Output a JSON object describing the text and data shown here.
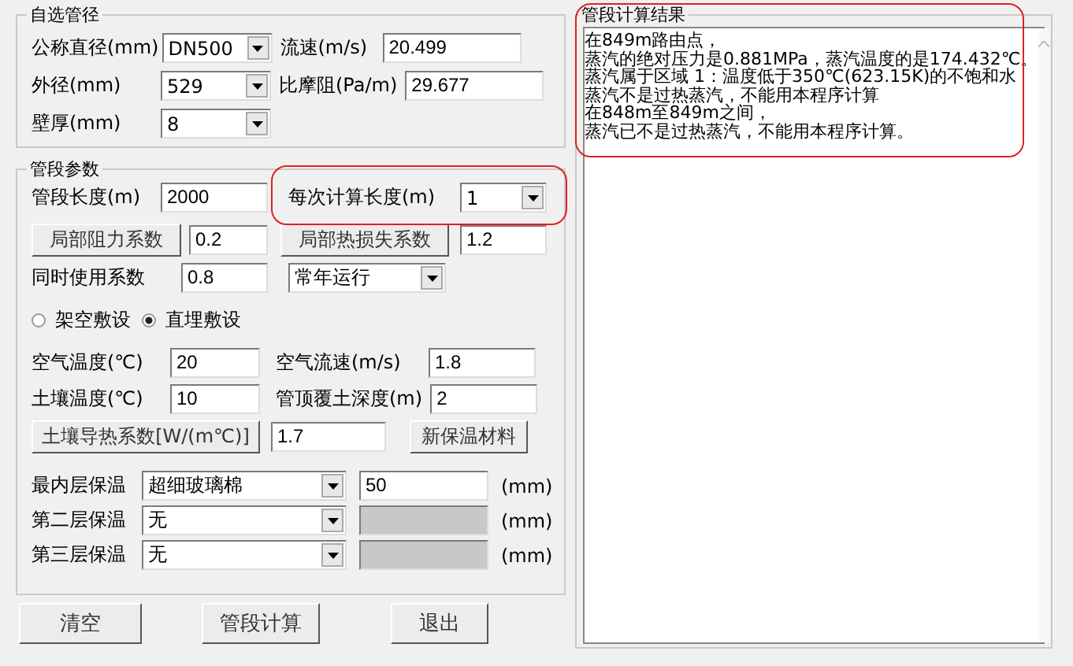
{
  "pipe_size_group": {
    "title": "自选管径",
    "rows": [
      [
        {
          "kind": "label",
          "text": "公称直径(mm)"
        },
        {
          "kind": "dropdown",
          "value": "DN500"
        },
        {
          "kind": "label",
          "text": "流速(m/s)"
        },
        {
          "kind": "input",
          "value": "20.499"
        }
      ],
      [
        {
          "kind": "label",
          "text": "外径(mm)"
        },
        {
          "kind": "dropdown",
          "value": "529"
        },
        {
          "kind": "label",
          "text": "比摩阻(Pa/m)"
        },
        {
          "kind": "input",
          "value": "29.677"
        }
      ],
      [
        {
          "kind": "label",
          "text": "壁厚(mm)"
        },
        {
          "kind": "dropdown",
          "value": "8"
        }
      ]
    ]
  },
  "segment_group": {
    "title": "管段参数",
    "rows": [
      [
        {
          "kind": "label",
          "text": "管段长度(m)"
        },
        {
          "kind": "input",
          "value": "2000"
        },
        {
          "kind": "label",
          "text": "每次计算长度(m)"
        },
        {
          "kind": "dropdown",
          "value": "1"
        }
      ],
      [
        {
          "kind": "button",
          "text": "局部阻力系数"
        },
        {
          "kind": "input",
          "value": "0.2"
        },
        {
          "kind": "button",
          "text": "局部热损失系数"
        },
        {
          "kind": "input",
          "value": "1.2"
        }
      ],
      [
        {
          "kind": "label",
          "text": "同时使用系数"
        },
        {
          "kind": "input",
          "value": "0.8"
        },
        {
          "kind": "dropdown",
          "value": "常年运行"
        }
      ],
      [
        {
          "kind": "radio",
          "text": "架空敷设",
          "selected": false
        },
        {
          "kind": "radio",
          "text": "直埋敷设",
          "selected": true
        }
      ],
      [
        {
          "kind": "label",
          "text": "空气温度(℃)"
        },
        {
          "kind": "input",
          "value": "20"
        },
        {
          "kind": "label",
          "text": "空气流速(m/s)"
        },
        {
          "kind": "input",
          "value": "1.8"
        }
      ],
      [
        {
          "kind": "label",
          "text": "土壤温度(℃)"
        },
        {
          "kind": "input",
          "value": "10"
        },
        {
          "kind": "label",
          "text": "管顶覆土深度(m)"
        },
        {
          "kind": "input",
          "value": "2"
        }
      ],
      [
        {
          "kind": "button",
          "text": "土壤导热系数[W/(m℃)]"
        },
        {
          "kind": "input",
          "value": "1.7"
        },
        {
          "kind": "button",
          "text": "新保温材料"
        }
      ],
      [
        {
          "kind": "label",
          "text": "最内层保温"
        },
        {
          "kind": "dropdown",
          "value": "超细玻璃棉"
        },
        {
          "kind": "input",
          "value": "50",
          "disabled": false
        },
        {
          "kind": "unit",
          "text": "(mm)"
        }
      ],
      [
        {
          "kind": "label",
          "text": "第二层保温"
        },
        {
          "kind": "dropdown",
          "value": "无"
        },
        {
          "kind": "input",
          "disabled": true
        },
        {
          "kind": "unit",
          "text": "(mm)"
        }
      ],
      [
        {
          "kind": "label",
          "text": "第三层保温"
        },
        {
          "kind": "dropdown",
          "value": "无"
        },
        {
          "kind": "input",
          "disabled": true
        },
        {
          "kind": "unit",
          "text": "(mm)"
        }
      ]
    ]
  },
  "buttons": [
    "清空",
    "管段计算",
    "退出"
  ],
  "result_group": {
    "title": "管段计算结果",
    "lines": [
      "在849m路由点，",
      "蒸汽的绝对压力是0.881MPa，蒸汽温度的是174.432℃。",
      "蒸汽属于区域 1：温度低于350℃(623.15K)的不饱和水",
      "蒸汽不是过热蒸汽，不能用本程序计算",
      "在848m至849m之间，",
      "蒸汽已不是过热蒸汽，不能用本程序计算。"
    ]
  }
}
